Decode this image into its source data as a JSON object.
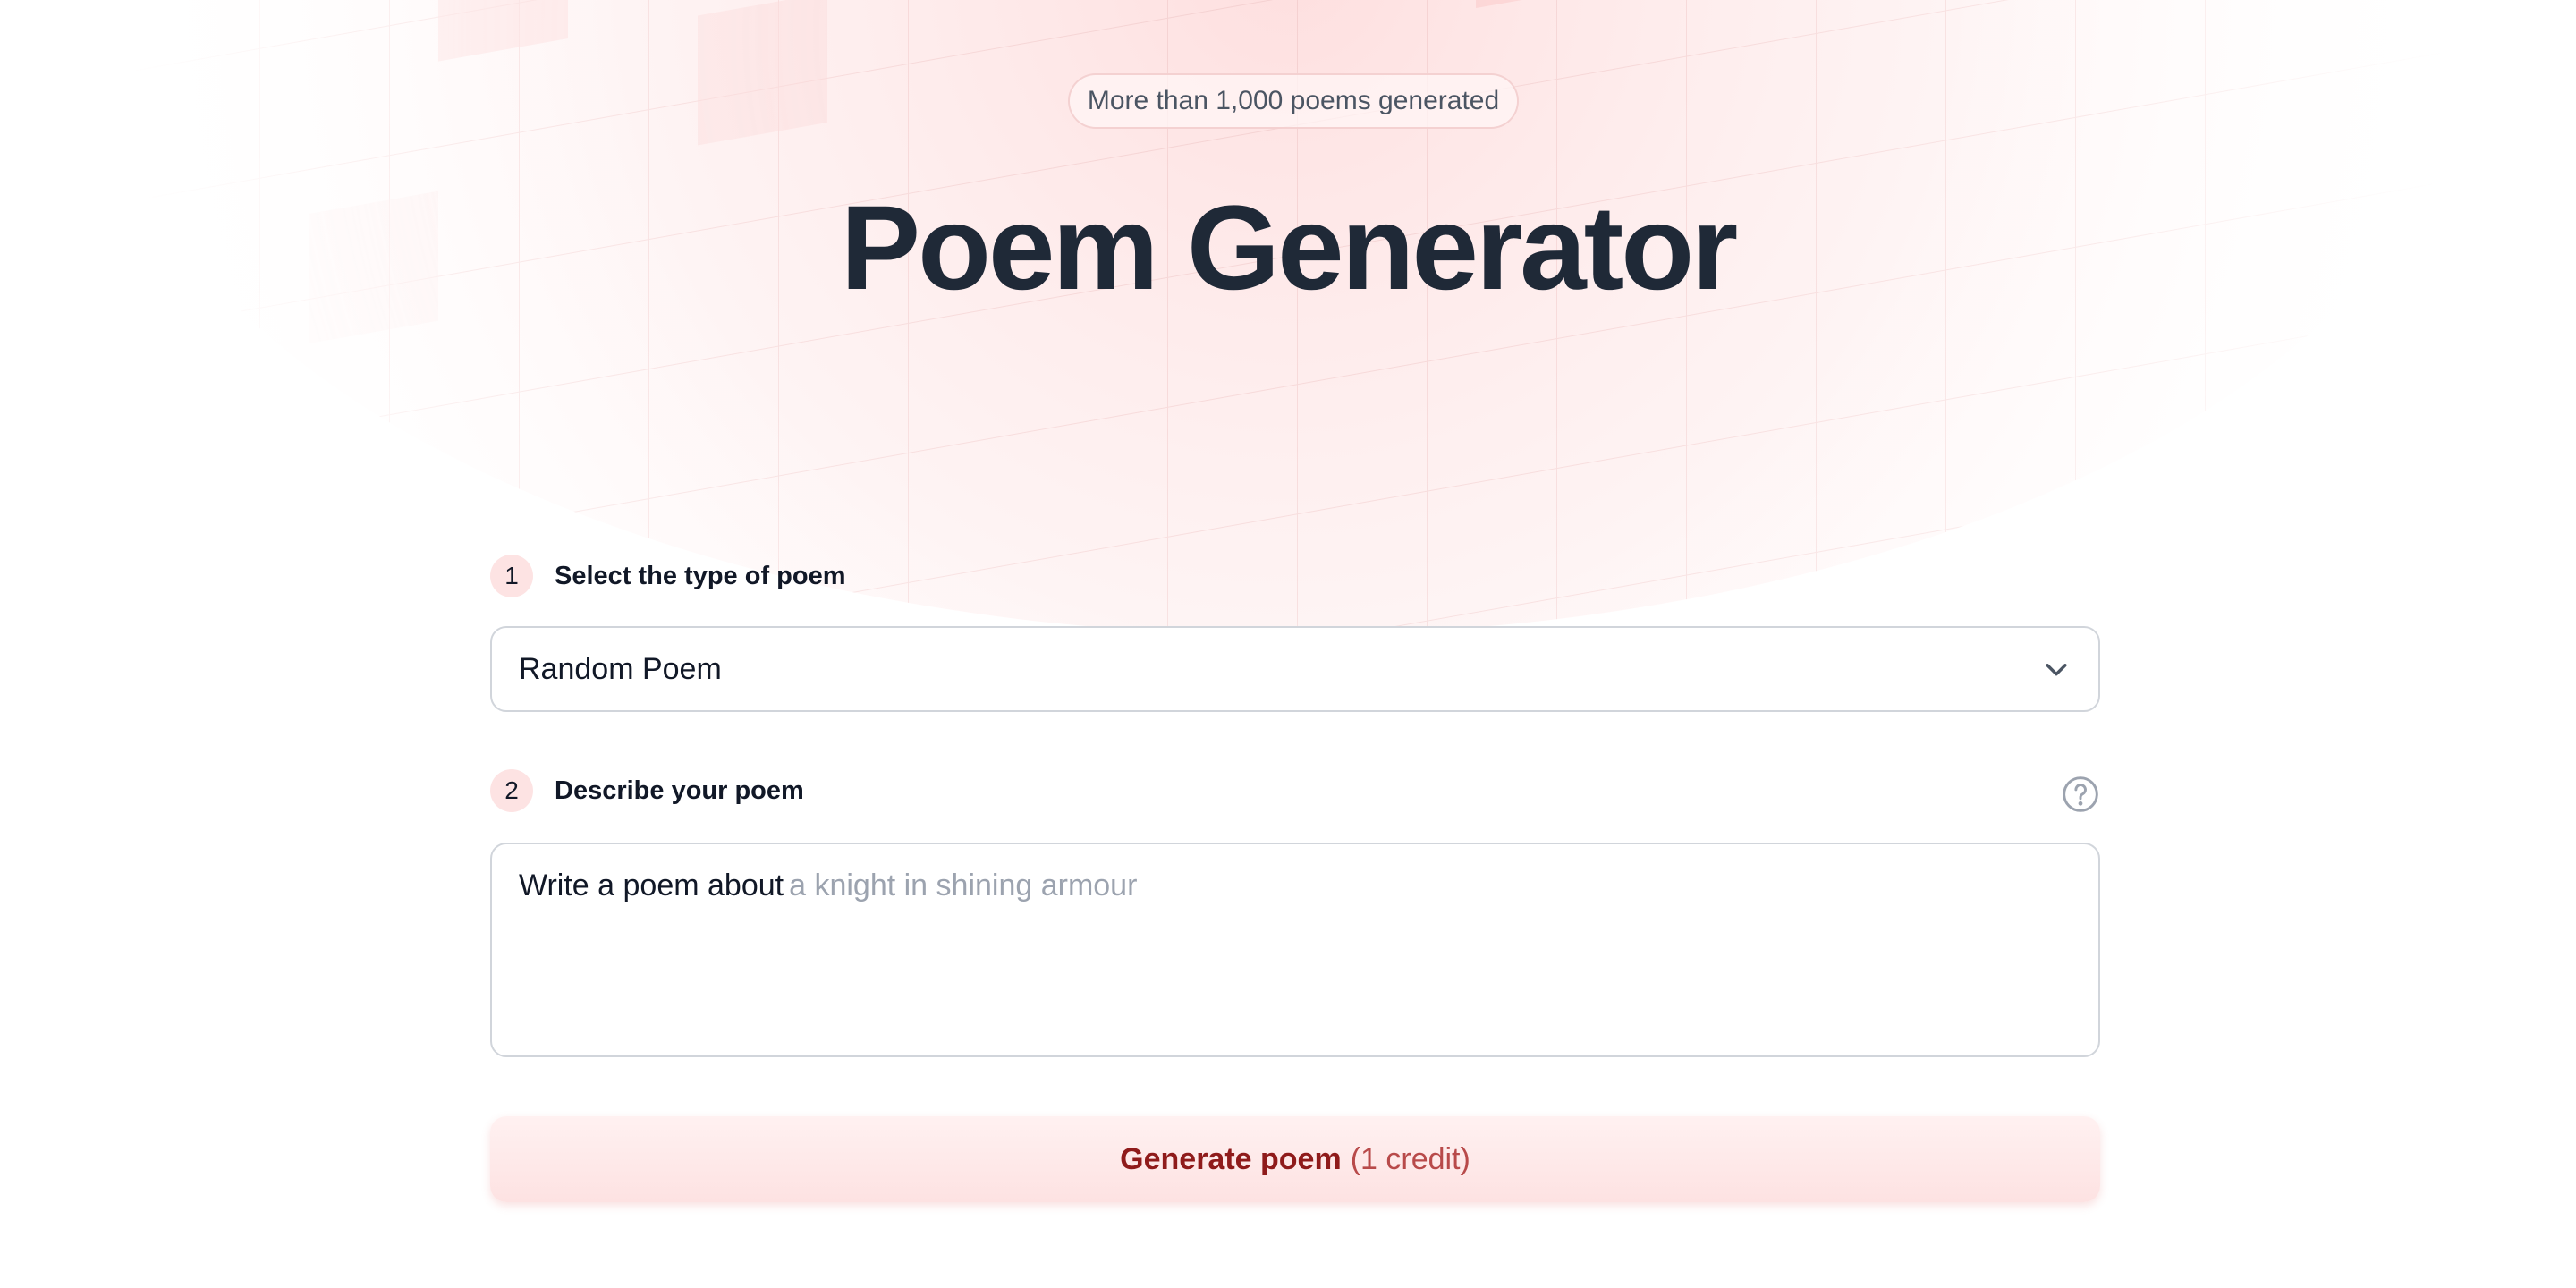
{
  "hero": {
    "badge_text": "More than 1,000 poems generated",
    "title": "Poem Generator"
  },
  "form": {
    "step1": {
      "number": "1",
      "label": "Select the type of poem",
      "selected_value": "Random Poem",
      "chevron_icon": "chevron-down-icon"
    },
    "step2": {
      "number": "2",
      "label": "Describe your poem",
      "help_icon": "question-circle-icon",
      "prefix": "Write a poem about",
      "placeholder": "a knight in shining armour"
    },
    "submit": {
      "label": "Generate poem",
      "credit": "(1 credit)"
    }
  },
  "colors": {
    "accent": "#fde3e3",
    "title": "#1f2937",
    "button_text": "#8f1b1b",
    "placeholder": "#9ca3af"
  }
}
